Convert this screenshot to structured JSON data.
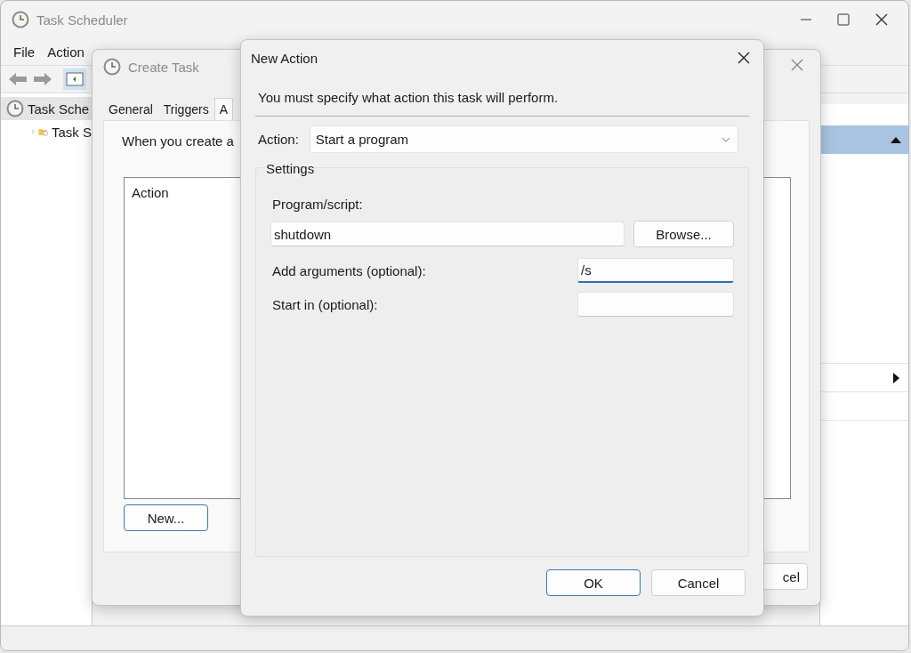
{
  "main_window": {
    "title": "Task Scheduler",
    "menu": [
      "File",
      "Action"
    ],
    "tree": [
      {
        "label": "Task Sche",
        "selected": true,
        "children": [
          {
            "label": "Task S",
            "expanded": false
          }
        ]
      }
    ]
  },
  "create_task": {
    "title": "Create Task",
    "tabs": [
      {
        "label": "General",
        "selected": false
      },
      {
        "label": "Triggers",
        "selected": false
      },
      {
        "label": "A",
        "selected": true
      }
    ],
    "description": "When you create a",
    "list_header": "Action",
    "new_button": {
      "label": "New...",
      "default": true
    },
    "cancel_button": {
      "label": "cel",
      "default": false
    }
  },
  "new_action": {
    "title": "New Action",
    "instruction": "You must specify what action this task will perform.",
    "action": {
      "label": "Action:",
      "value": "Start a program"
    },
    "settings": {
      "title": "Settings",
      "program": {
        "label": "Program/script:",
        "value": "shutdown",
        "button": "Browse..."
      },
      "fields": [
        {
          "label": "Add arguments (optional):",
          "value": "/s",
          "focused": true
        },
        {
          "label": "Start in (optional):",
          "focused": false
        }
      ]
    },
    "buttons": [
      {
        "label": "OK",
        "default": true
      },
      {
        "label": "Cancel",
        "default": false
      }
    ]
  }
}
